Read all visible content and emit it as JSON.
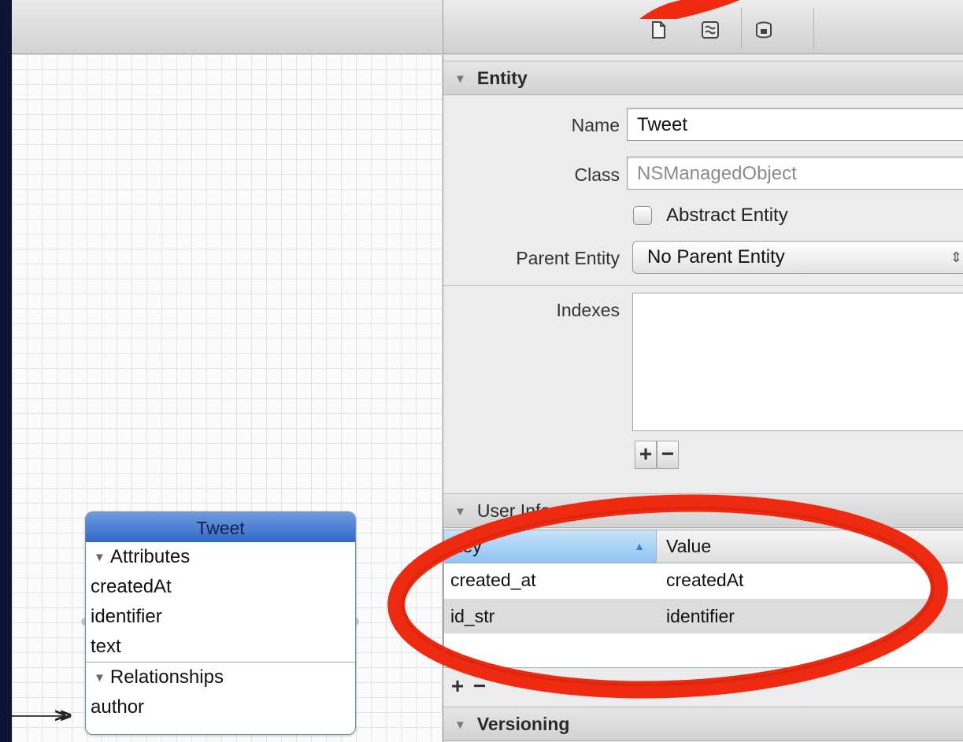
{
  "toolbar": {
    "icons": [
      "data-model-inspector-icon",
      "quick-help-icon",
      "data-store-icon"
    ]
  },
  "canvas": {
    "entity": {
      "title": "Tweet",
      "attributes_label": "Attributes",
      "attributes": [
        "createdAt",
        "identifier",
        "text"
      ],
      "relationships_label": "Relationships",
      "relationships": [
        "author"
      ]
    }
  },
  "inspector": {
    "entity_section": {
      "title": "Entity",
      "name_label": "Name",
      "name_value": "Tweet",
      "class_label": "Class",
      "class_placeholder": "NSManagedObject",
      "abstract_label": "Abstract Entity",
      "abstract_checked": false,
      "parent_label": "Parent Entity",
      "parent_value": "No Parent Entity",
      "indexes_label": "Indexes",
      "add_symbol": "+",
      "remove_symbol": "−"
    },
    "user_info": {
      "title": "User Info",
      "columns": {
        "key": "Key",
        "value": "Value"
      },
      "rows": [
        {
          "key": "created_at",
          "value": "createdAt"
        },
        {
          "key": "id_str",
          "value": "identifier"
        }
      ],
      "add_symbol": "+",
      "remove_symbol": "−"
    },
    "versioning": {
      "title": "Versioning"
    }
  },
  "colors": {
    "annotation": "#ee2a10",
    "entity_header": "#3269c9",
    "selected_column": "#8ec4f2"
  }
}
